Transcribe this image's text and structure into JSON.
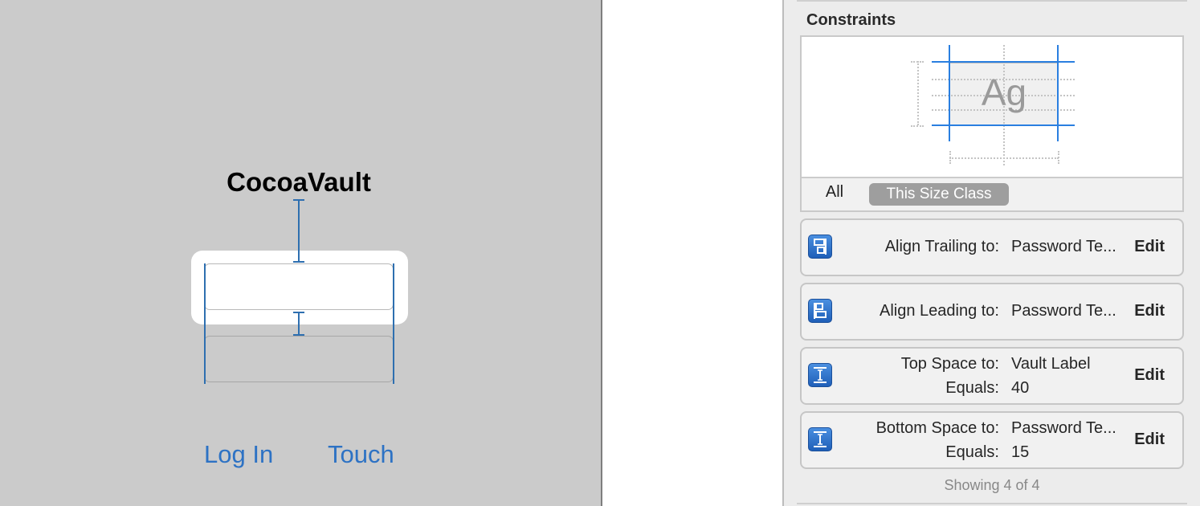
{
  "canvas": {
    "app_title": "CocoaVault",
    "login_label": "Log In",
    "touch_label": "Touch"
  },
  "inspector": {
    "section_title": "Constraints",
    "preview_sample": "Ag",
    "segments": [
      "All",
      "This Size Class"
    ],
    "selected_segment": "This Size Class",
    "constraints": [
      {
        "label": "Align Trailing to:",
        "value": "Password Te...",
        "edit": "Edit",
        "icon": "align-trailing-icon"
      },
      {
        "label": "Align Leading to:",
        "value": "Password Te...",
        "edit": "Edit",
        "icon": "align-leading-icon"
      },
      {
        "label": "Top Space to:",
        "value": "Vault Label",
        "equals_label": "Equals:",
        "equals_value": "40",
        "edit": "Edit",
        "icon": "vertical-space-icon"
      },
      {
        "label": "Bottom Space to:",
        "value": "Password Te...",
        "equals_label": "Equals:",
        "equals_value": "15",
        "edit": "Edit",
        "icon": "vertical-space-icon"
      }
    ],
    "footer": "Showing 4 of 4"
  },
  "colors": {
    "canvas_bg": "#cbcbcb",
    "link_blue": "#2d72c4",
    "guide_blue": "#2e6fb0",
    "icon_blue": "#2f74cf",
    "selected_segment_bg": "#9e9e9e"
  }
}
